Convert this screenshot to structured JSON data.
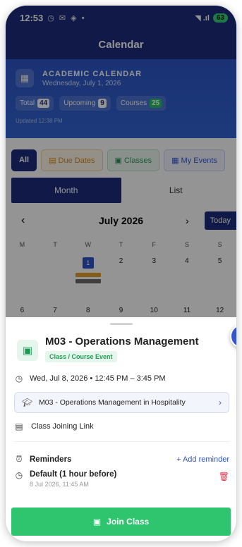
{
  "status_bar": {
    "time": "12:53",
    "icons": "◷ ✉ ◈ •",
    "signal": "◥ .ıl",
    "battery": "63"
  },
  "header": {
    "title": "Calendar"
  },
  "hero": {
    "title": "ACADEMIC CALENDAR",
    "subtitle": "Wednesday, July 1, 2026",
    "stats": [
      {
        "label": "Total",
        "value": "44"
      },
      {
        "label": "Upcoming",
        "value": "9"
      },
      {
        "label": "Courses",
        "value": "25"
      }
    ],
    "updated": "Updated 12:38 PM"
  },
  "filters": {
    "all": "All",
    "due": "Due Dates",
    "classes": "Classes",
    "events": "My Events"
  },
  "view_toggle": {
    "month": "Month",
    "list": "List"
  },
  "month_nav": {
    "prev": "‹",
    "label": "July 2026",
    "next": "›",
    "today": "Today"
  },
  "weekdays": [
    "M",
    "T",
    "W",
    "T",
    "F",
    "S",
    "S"
  ],
  "week1": [
    "",
    "",
    "1",
    "2",
    "3",
    "4",
    "5"
  ],
  "week2": [
    "6",
    "7",
    "8",
    "9",
    "10",
    "11",
    "12"
  ],
  "event": {
    "title": "M03 - Operations Management",
    "type": "Class / Course Event",
    "datetime": "Wed, Jul 8, 2026 • 12:45 PM – 3:45 PM",
    "course": "M03 - Operations Management in Hospitality",
    "join_link": "Class Joining Link",
    "reminders_label": "Reminders",
    "add_reminder": "+ Add reminder",
    "reminder_name": "Default (1 hour before)",
    "reminder_time": "8 Jul 2026, 11:45 AM",
    "join_button": "Join Class"
  },
  "colors": {
    "brand": "#1c2b7a",
    "accent": "#2d56c7",
    "success": "#2ec56e",
    "danger": "#e0364a"
  }
}
